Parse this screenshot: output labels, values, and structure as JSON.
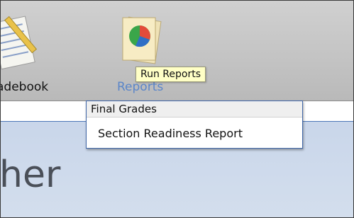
{
  "toolbar": {
    "gradebook_label": "adebook",
    "reports_label": "Reports",
    "tooltip": "Run Reports"
  },
  "menu": {
    "items": [
      {
        "label": "Final Grades"
      },
      {
        "label": "Section Readiness Report"
      }
    ]
  },
  "content": {
    "partial_heading": "her"
  },
  "icons": {
    "gradebook": "gradebook-icon",
    "reports": "reports-pie-chart-icon"
  },
  "colors": {
    "toolbar_bg": "#c3c3c3",
    "accent": "#5b86c9",
    "menu_border": "#3f66a8",
    "content_bg": "#cdd9ec",
    "tooltip_bg": "#ffffc6"
  }
}
